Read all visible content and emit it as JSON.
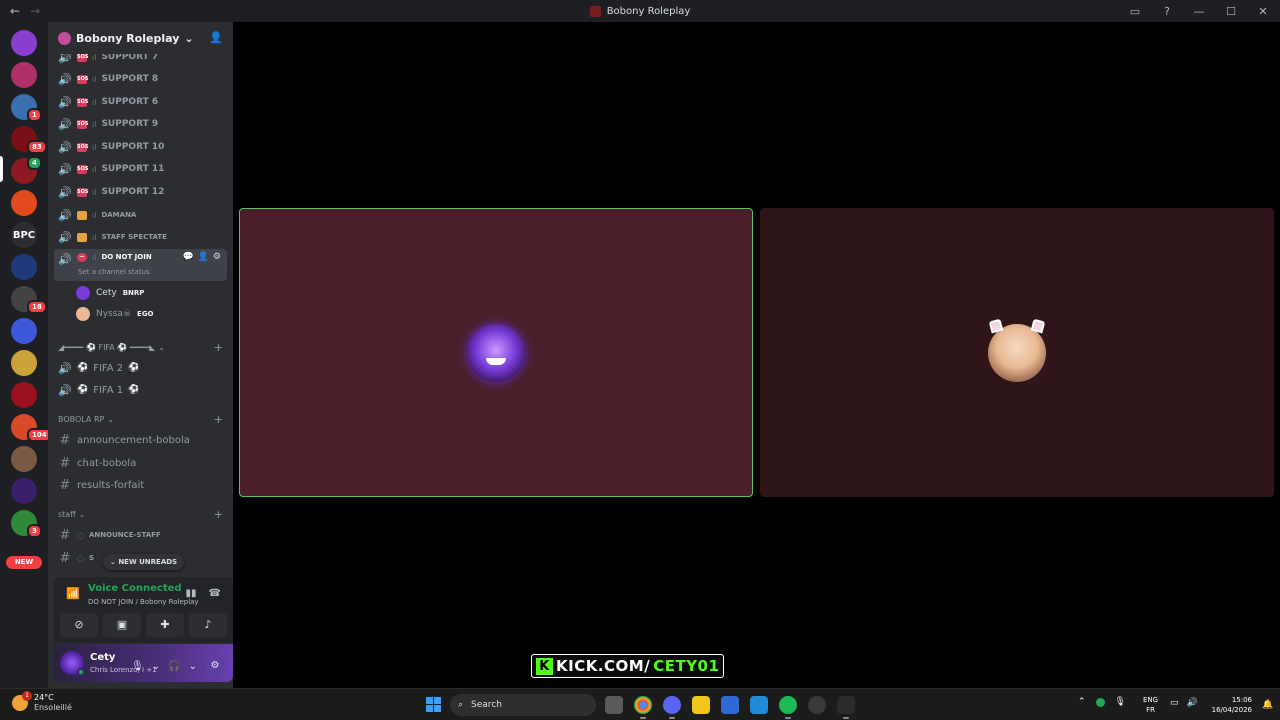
{
  "window": {
    "title": "Bobony Roleplay",
    "back": "←",
    "forward": "→",
    "inbox_icon": "▭",
    "help_icon": "?",
    "minimize": "—",
    "maximize": "☐",
    "close": "✕"
  },
  "rail": {
    "servers": [
      {
        "label": "",
        "color": "#8a3fd1",
        "badge": ""
      },
      {
        "label": "",
        "color": "#b0306a",
        "badge": ""
      },
      {
        "label": "",
        "color": "#3a6fb0",
        "badge": "1"
      },
      {
        "label": "",
        "color": "#7a0f16",
        "badge": "83"
      },
      {
        "label": "",
        "color": "#8c1a22",
        "badge": "4"
      },
      {
        "label": "",
        "color": "#e24a1e",
        "badge": ""
      },
      {
        "label": "BPC",
        "color": "#2b2d31",
        "badge": ""
      },
      {
        "label": "",
        "color": "#1f3a7a",
        "badge": ""
      },
      {
        "label": "",
        "color": "#444444",
        "badge": "18"
      },
      {
        "label": "",
        "color": "#3f57d9",
        "badge": ""
      },
      {
        "label": "",
        "color": "#c9a33a",
        "badge": ""
      },
      {
        "label": "",
        "color": "#9a1220",
        "badge": ""
      },
      {
        "label": "",
        "color": "#d84a2a",
        "badge": "104"
      },
      {
        "label": "",
        "color": "#7a5a45",
        "badge": ""
      },
      {
        "label": "",
        "color": "#3a1f6a",
        "badge": ""
      },
      {
        "label": "",
        "color": "#2f8a3a",
        "badge": "3"
      }
    ],
    "new_label": "NEW"
  },
  "sidebar": {
    "guild_name": "Bobony Roleplay",
    "support_channels": [
      "SUPPORT 7",
      "SUPPORT 8",
      "SUPPORT 6",
      "SUPPORT 9",
      "SUPPORT 10",
      "SUPPORT 11",
      "SUPPORT 12"
    ],
    "damana": "DAMANA",
    "staff_spectate": "STAFF SPECTATE",
    "do_not_join": "DO NOT JOIN",
    "set_status": "Set a channel status",
    "users": [
      {
        "name": "Cety",
        "tag": "BNRP"
      },
      {
        "name": "Nyssa☠",
        "tag": "EGO"
      }
    ],
    "fifa_category": "◢━━━━ ⚽ FIFA ⚽ ━━━━◣",
    "fifa_channels": [
      "FIFA 2",
      "FIFA 1"
    ],
    "bobola_category": "BOBOLA RP",
    "bobola_channels": [
      "announcement-bobola",
      "chat-bobola",
      "results-forfait"
    ],
    "staff_category": "staff",
    "staff_channels": [
      "ANNOUNCE-STAFF",
      "S"
    ],
    "new_unreads": "NEW UNREADS"
  },
  "voice": {
    "status": "Voice Connected",
    "channel": "DO NOT JOIN / Bobony Roleplay"
  },
  "user_panel": {
    "name": "Cety",
    "activity": "Chris Lorenzo, I +1"
  },
  "stage": {
    "overlay_k": "K",
    "overlay_domain": "KICK.COM/",
    "overlay_handle": "CETY01"
  },
  "taskbar": {
    "weather_badge": "1",
    "temperature": "24°C",
    "condition": "Ensoleillé",
    "search_placeholder": "Search",
    "lang_top": "ENG",
    "lang_bottom": "FR",
    "time": "15:06",
    "date": "16/04/2026"
  },
  "colors": {
    "accent_green": "#23a55a",
    "kick_green": "#53fc18",
    "tile_active": "#4a1f2a",
    "tile_idle": "#2f1519"
  }
}
